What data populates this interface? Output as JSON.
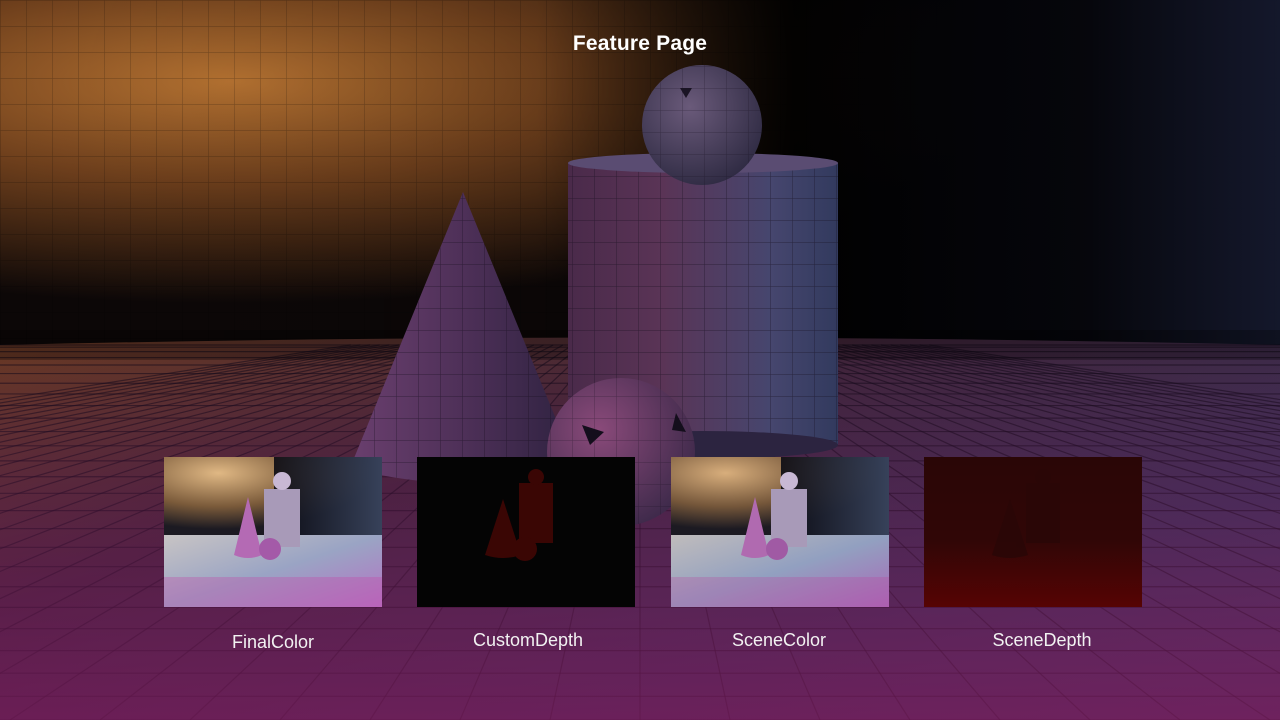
{
  "page": {
    "title": "Feature Page"
  },
  "scene": {
    "warm_light_color": "#b06a2a",
    "cool_light_color": "#3a4a78",
    "object_color": "#6a4a78",
    "floor_tint": "#7a2a6a"
  },
  "thumbnails": [
    {
      "id": "finalcolor",
      "label": "FinalColor",
      "style": "color"
    },
    {
      "id": "customdepth",
      "label": "CustomDepth",
      "style": "customdepth"
    },
    {
      "id": "scenecolor",
      "label": "SceneColor",
      "style": "color"
    },
    {
      "id": "scenedepth",
      "label": "SceneDepth",
      "style": "scenedepth"
    }
  ]
}
